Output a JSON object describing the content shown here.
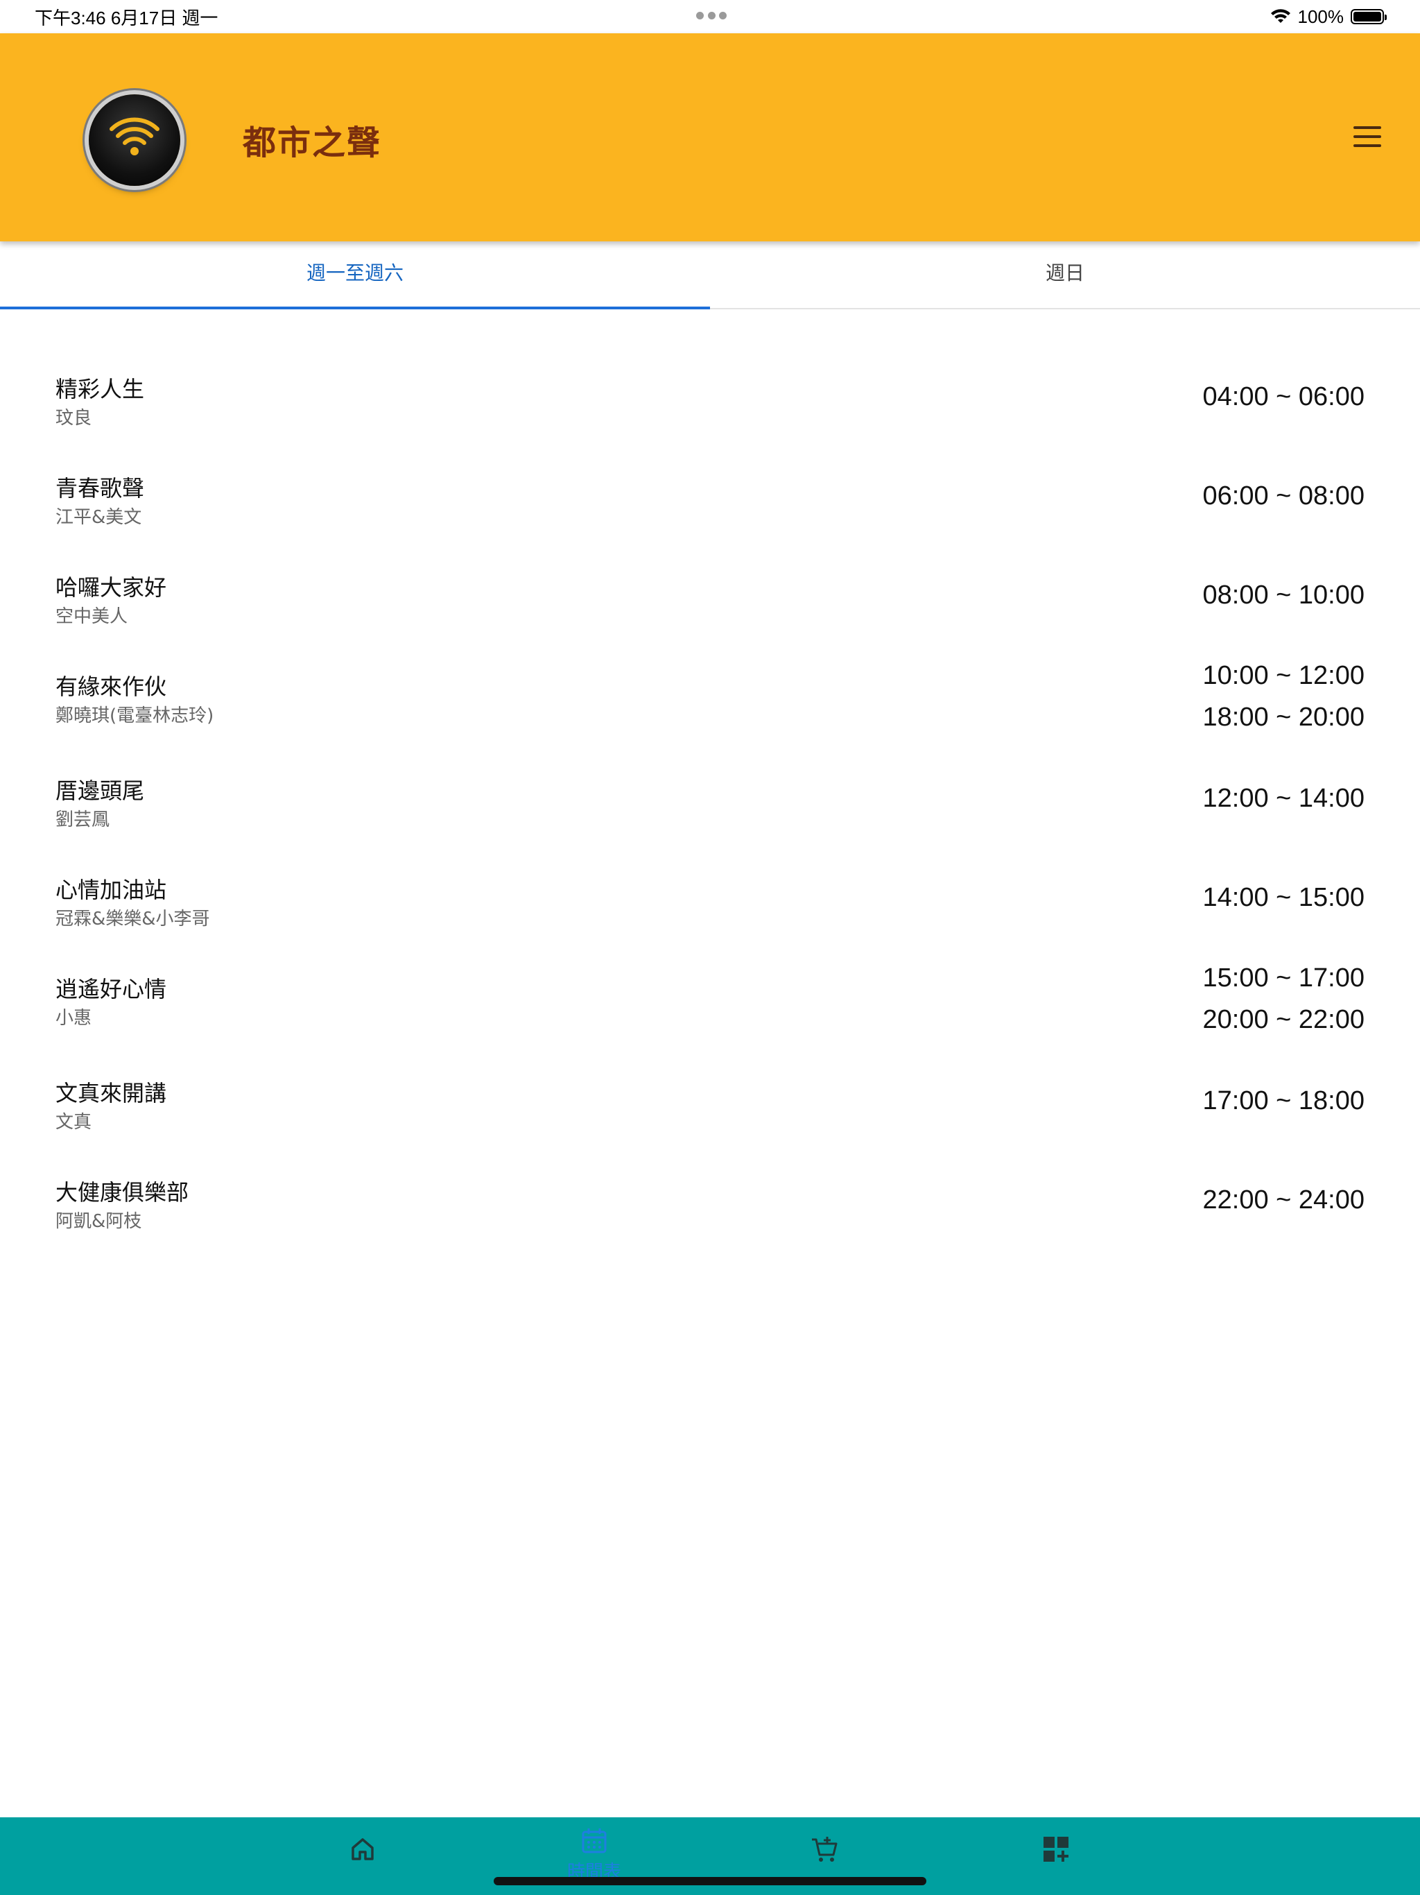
{
  "status_bar": {
    "time_date": "下午3:46   6月17日 週一",
    "battery": "100%"
  },
  "header": {
    "title": "都市之聲",
    "logo_icon": "wifi-logo-icon",
    "menu_icon": "hamburger-menu-icon",
    "bg_color": "#FBB41F",
    "title_color": "#7A2E0E"
  },
  "tabs": [
    {
      "label": "週一至週六",
      "active": true
    },
    {
      "label": "週日",
      "active": false
    }
  ],
  "programs": [
    {
      "name": "精彩人生",
      "host": "玟良",
      "times": [
        "04:00 ~ 06:00"
      ]
    },
    {
      "name": "青春歌聲",
      "host": "江平&美文",
      "times": [
        "06:00 ~ 08:00"
      ]
    },
    {
      "name": "哈囉大家好",
      "host": "空中美人",
      "times": [
        "08:00 ~ 10:00"
      ]
    },
    {
      "name": "有緣來作伙",
      "host": "鄭曉琪(電臺林志玲)",
      "times": [
        "10:00 ~ 12:00",
        "18:00 ~ 20:00"
      ]
    },
    {
      "name": "厝邊頭尾",
      "host": "劉芸鳳",
      "times": [
        "12:00 ~ 14:00"
      ]
    },
    {
      "name": "心情加油站",
      "host": "冠霖&樂樂&小李哥",
      "times": [
        "14:00 ~ 15:00"
      ]
    },
    {
      "name": "逍遙好心情",
      "host": "小惠",
      "times": [
        "15:00 ~ 17:00",
        "20:00 ~ 22:00"
      ]
    },
    {
      "name": "文真來開講",
      "host": "文真",
      "times": [
        "17:00 ~ 18:00"
      ]
    },
    {
      "name": "大健康俱樂部",
      "host": "阿凱&阿枝",
      "times": [
        "22:00 ~ 24:00"
      ]
    }
  ],
  "bottom_nav": {
    "bg_color": "#00A0A0",
    "items": [
      {
        "icon": "home-icon"
      },
      {
        "icon": "calendar-icon",
        "label": "時間表",
        "active": true
      },
      {
        "icon": "cart-add-icon"
      },
      {
        "icon": "apps-add-icon"
      }
    ]
  }
}
